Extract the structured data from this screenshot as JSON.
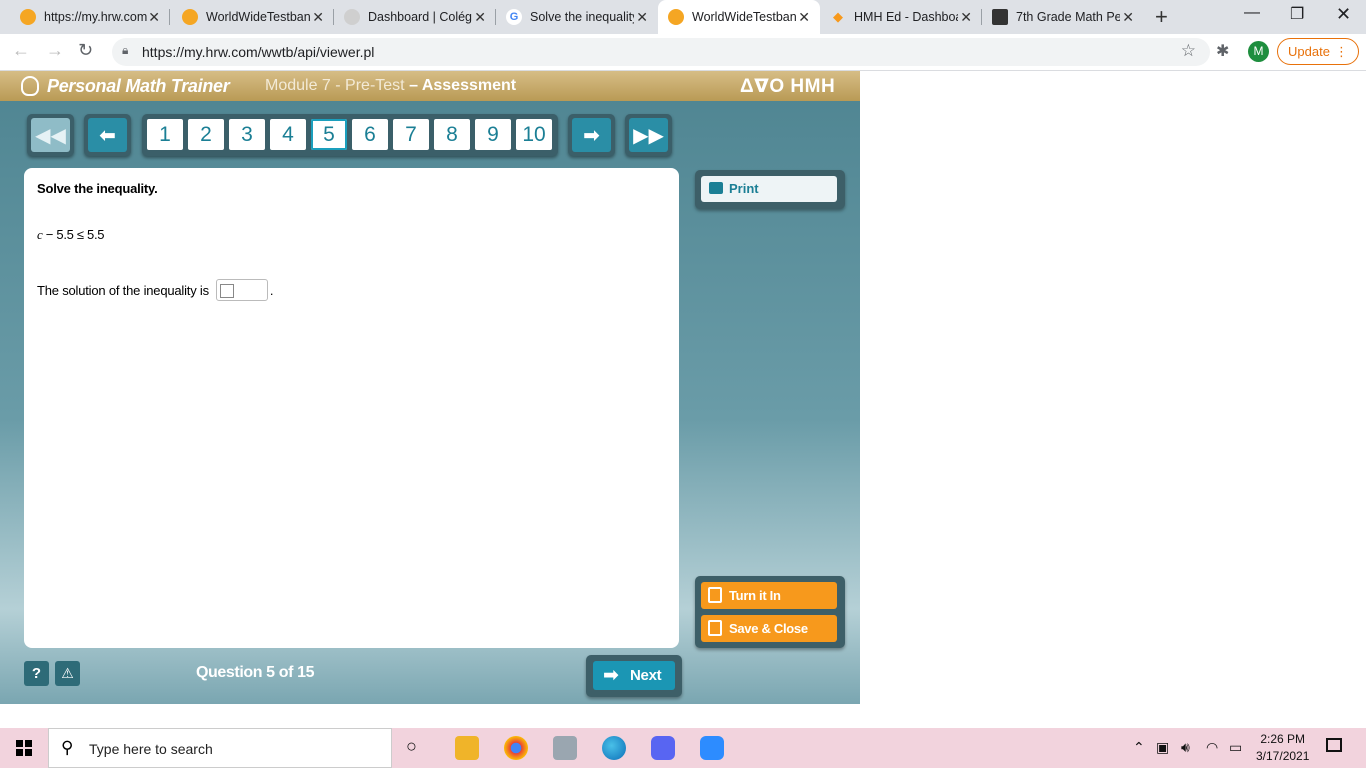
{
  "browser": {
    "tabs": [
      {
        "title": "https://my.hrw.com",
        "favicon": "circle-icon",
        "color": "#f5a623",
        "active": false
      },
      {
        "title": "WorldWideTestbank",
        "favicon": "circle-icon",
        "color": "#f5a623",
        "active": false
      },
      {
        "title": "Dashboard | Colégio",
        "favicon": "globe-icon",
        "color": "#bbbbbb",
        "active": false
      },
      {
        "title": "Solve the inequality",
        "favicon": "google-icon",
        "color": "#4285f4",
        "active": false
      },
      {
        "title": "WorldWideTestbank",
        "favicon": "circle-icon",
        "color": "#f5a623",
        "active": true
      },
      {
        "title": "HMH Ed - Dashboard",
        "favicon": "shield-icon",
        "color": "#f7991c",
        "active": false
      },
      {
        "title": "7th Grade Math Pe",
        "favicon": "id-card-icon",
        "color": "#333333",
        "active": false
      }
    ],
    "url": "https://my.hrw.com/wwtb/api/viewer.pl",
    "profile_initial": "M",
    "update_label": "Update"
  },
  "app": {
    "brand": "Personal Math Trainer",
    "module_title": "Module 7 - Pre-Test",
    "module_suffix": "– Assessment",
    "publisher": "ΔᐁO HMH",
    "question_numbers": [
      "1",
      "2",
      "3",
      "4",
      "5",
      "6",
      "7",
      "8",
      "9",
      "10"
    ],
    "current_question": "5",
    "prompt": "Solve the inequality.",
    "inequality_var": "c",
    "inequality_rest": " − 5.5 ≤ 5.5",
    "solution_label": "The solution of the inequality is",
    "solution_value": "",
    "print_label": "Print",
    "turn_in_label": "Turn it In",
    "save_close_label": "Save & Close",
    "help_label": "?",
    "alert_label": "⚠",
    "question_counter": "Question 5 of 15",
    "next_label": "Next"
  },
  "taskbar": {
    "search_placeholder": "Type here to search",
    "time": "2:26 PM",
    "date": "3/17/2021"
  }
}
